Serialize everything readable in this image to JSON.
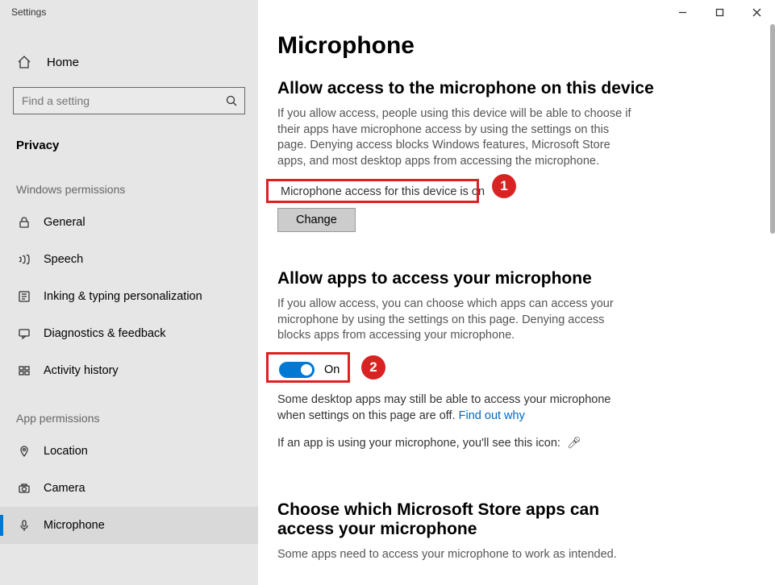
{
  "window": {
    "title": "Settings"
  },
  "sidebar": {
    "home": "Home",
    "search_placeholder": "Find a setting",
    "current": "Privacy",
    "group1_head": "Windows permissions",
    "group1": [
      {
        "label": "General"
      },
      {
        "label": "Speech"
      },
      {
        "label": "Inking & typing personalization"
      },
      {
        "label": "Diagnostics & feedback"
      },
      {
        "label": "Activity history"
      }
    ],
    "group2_head": "App permissions",
    "group2": [
      {
        "label": "Location"
      },
      {
        "label": "Camera"
      },
      {
        "label": "Microphone"
      }
    ]
  },
  "main": {
    "page_title": "Microphone",
    "s1": {
      "heading": "Allow access to the microphone on this device",
      "body": "If you allow access, people using this device will be able to choose if their apps have microphone access by using the settings on this page. Denying access blocks Windows features, Microsoft Store apps, and most desktop apps from accessing the microphone.",
      "status": "Microphone access for this device is on",
      "change": "Change"
    },
    "s2": {
      "heading": "Allow apps to access your microphone",
      "body": "If you allow access, you can choose which apps can access your microphone by using the settings on this page. Denying access blocks apps from accessing your microphone.",
      "toggle_state": "On",
      "note_a": "Some desktop apps may still be able to access your microphone when settings on this page are off. ",
      "note_link": "Find out why",
      "note_b": "If an app is using your microphone, you'll see this icon:"
    },
    "s3": {
      "heading": "Choose which Microsoft Store apps can access your microphone",
      "body": "Some apps need to access your microphone to work as intended."
    }
  },
  "annotations": {
    "a1": "1",
    "a2": "2"
  }
}
